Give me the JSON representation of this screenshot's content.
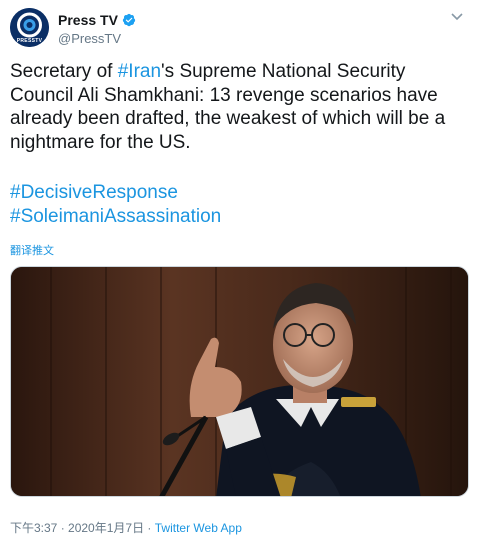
{
  "account": {
    "display_name": "Press TV",
    "handle": "@PressTV",
    "avatar_brand": "PRESSTV",
    "verified": true
  },
  "tweet": {
    "text_pre": "Secretary of ",
    "text_tag": "#Iran",
    "text_post": "'s Supreme National Security Council Ali Shamkhani: 13 revenge scenarios have already been drafted, the weakest of which will be a nightmare for the US.",
    "hashtags": [
      "#DecisiveResponse",
      "#SoleimaniAssassination"
    ],
    "translate_label": "翻译推文"
  },
  "meta": {
    "time": "下午3:37",
    "separator": " · ",
    "date": "2020年1月7日",
    "source": "Twitter Web App"
  },
  "colors": {
    "link": "#1b95e0",
    "text": "#14171a",
    "muted": "#657786"
  },
  "icons": {
    "verified": "verified-badge-icon",
    "caret": "chevron-down-icon"
  }
}
